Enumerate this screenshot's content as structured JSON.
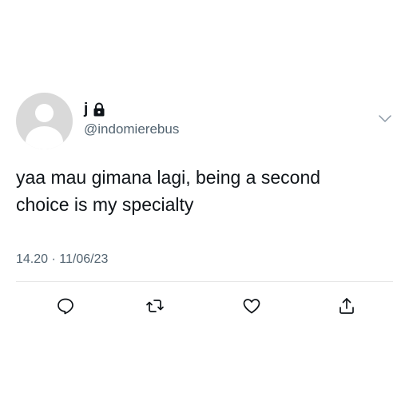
{
  "author": {
    "display_name": "j",
    "handle": "@indomierebus",
    "protected_icon": "lock-icon",
    "avatar_icon": "default-avatar"
  },
  "tweet": {
    "text_lines": [
      "yaa mau gimana lagi, being a second",
      "choice is my specialty"
    ],
    "time": "14.20",
    "separator": "·",
    "date": "11/06/23"
  },
  "actions": [
    {
      "icon": "reply-icon"
    },
    {
      "icon": "retweet-icon"
    },
    {
      "icon": "like-icon"
    },
    {
      "icon": "share-icon"
    }
  ],
  "menu": {
    "icon": "chevron-down-icon"
  },
  "colors": {
    "text": "#0f1419",
    "secondary": "#536471",
    "avatar_bg": "#d9d9d9",
    "divider": "#e6e6e6"
  }
}
